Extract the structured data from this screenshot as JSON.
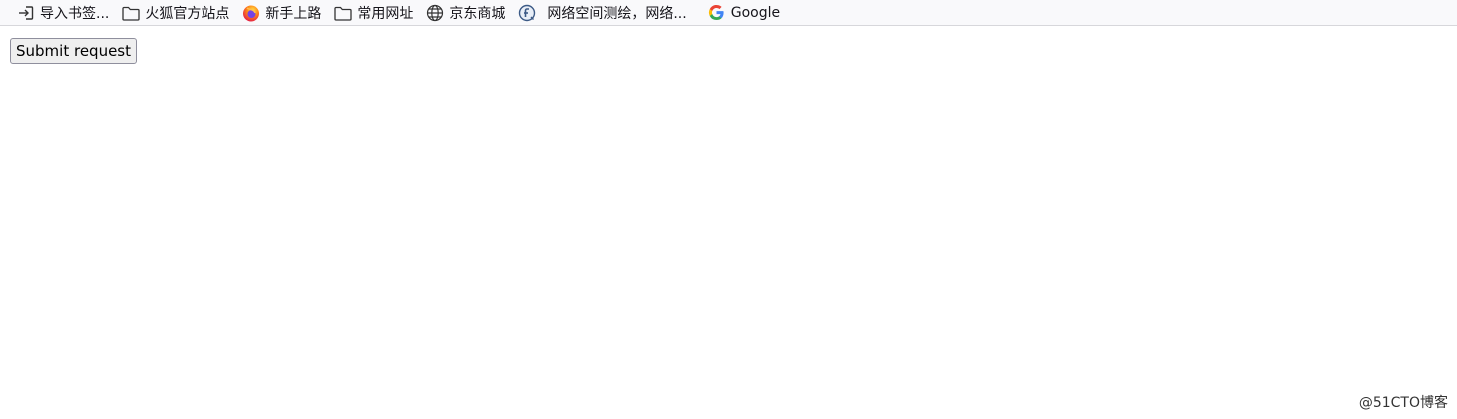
{
  "bookmarks": [
    {
      "label": "导入书签...",
      "icon": "import-icon"
    },
    {
      "label": "火狐官方站点",
      "icon": "folder-icon"
    },
    {
      "label": "新手上路",
      "icon": "firefox-icon"
    },
    {
      "label": "常用网址",
      "icon": "folder-icon"
    },
    {
      "label": "京东商城",
      "icon": "globe-icon"
    },
    {
      "label": "网络空间测绘，网络...",
      "icon": "fofa-icon"
    },
    {
      "label": "Google",
      "icon": "google-icon"
    }
  ],
  "form": {
    "submit_label": "Submit request"
  },
  "watermark": "@51CTO博客"
}
